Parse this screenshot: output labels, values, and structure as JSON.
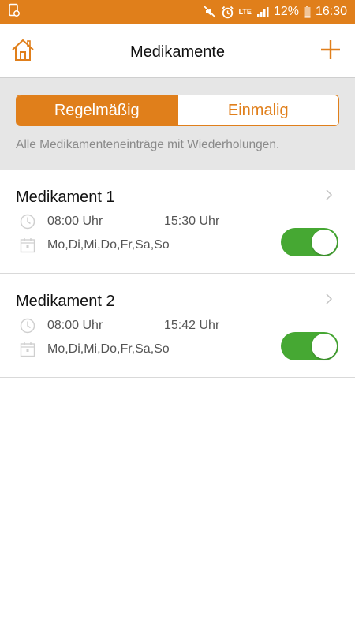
{
  "status_bar": {
    "battery": "12%",
    "time": "16:30",
    "network": "LTE",
    "icons": [
      "screenshot-icon",
      "mute-icon",
      "alarm-icon",
      "signal-icon",
      "battery-icon"
    ]
  },
  "header": {
    "title": "Medikamente",
    "home_icon": "home-icon",
    "add_icon": "plus-icon"
  },
  "segments": {
    "active_label": "Regelmäßig",
    "inactive_label": "Einmalig",
    "description": "Alle Medikamenteneinträge mit Wiederholungen."
  },
  "medications": [
    {
      "name": "Medikament 1",
      "time1": "08:00 Uhr",
      "time2": "15:30 Uhr",
      "days": "Mo,Di,Mi,Do,Fr,Sa,So",
      "enabled": true
    },
    {
      "name": "Medikament 2",
      "time1": "08:00 Uhr",
      "time2": "15:42 Uhr",
      "days": "Mo,Di,Mi,Do,Fr,Sa,So",
      "enabled": true
    }
  ],
  "colors": {
    "accent": "#e07f1b",
    "toggle_on": "#46a833",
    "segment_bg": "#e6e6e6"
  }
}
